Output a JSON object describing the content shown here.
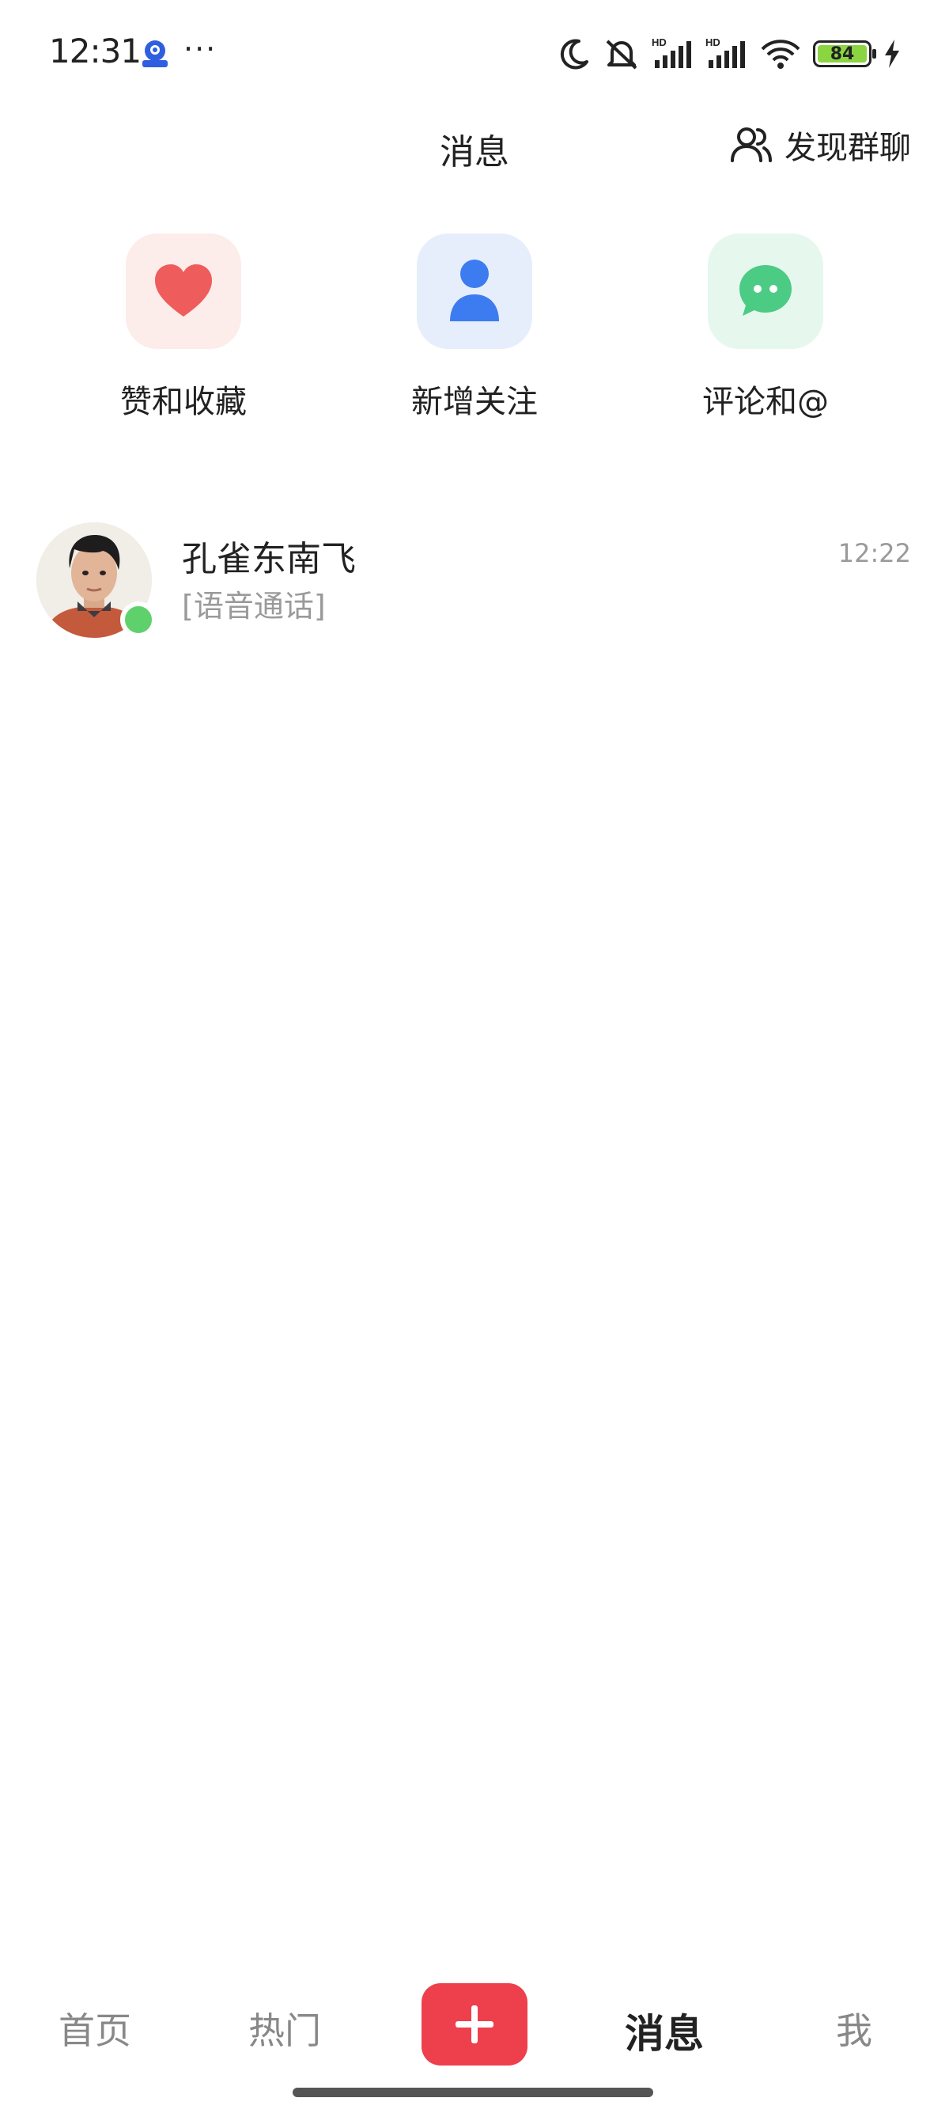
{
  "status_bar": {
    "time": "12:31",
    "dots": "···",
    "battery": "84",
    "icons": [
      "app-badge-icon",
      "moon-icon",
      "bell-off-icon",
      "signal-hd-icon",
      "signal-hd-icon",
      "wifi-icon",
      "battery-icon",
      "charging-icon"
    ]
  },
  "header": {
    "title": "消息",
    "discover_label": "发现群聊"
  },
  "quick_entries": [
    {
      "label": "赞和收藏",
      "icon": "heart-icon",
      "color": "#ee5c5c"
    },
    {
      "label": "新增关注",
      "icon": "person-icon",
      "color": "#3d7bf0"
    },
    {
      "label": "评论和@",
      "icon": "chat-bubble-icon",
      "color": "#4ccb84"
    }
  ],
  "conversations": [
    {
      "name": "孔雀东南飞",
      "preview": "[语音通话]",
      "time": "12:22",
      "online": true
    }
  ],
  "bottom_nav": {
    "tabs": [
      {
        "label": "首页"
      },
      {
        "label": "热门"
      },
      {
        "label": "消息",
        "active": true
      },
      {
        "label": "我"
      }
    ],
    "add_icon": "plus-icon",
    "accent": "#ee3f4d"
  }
}
